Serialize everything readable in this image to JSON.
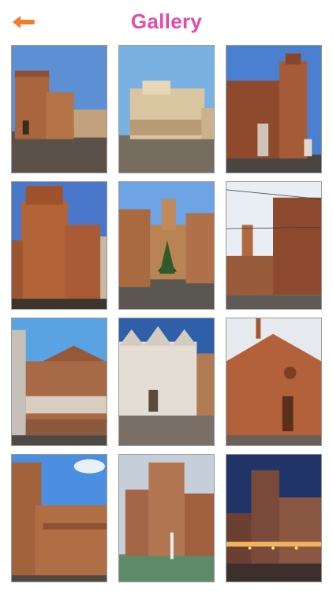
{
  "header": {
    "title": "Gallery",
    "back_icon": "back-arrow-icon",
    "back_color": "#f47a2c",
    "title_color": "#e64aa9"
  },
  "gallery": {
    "photos": [
      {
        "subject": "castle-tower-day"
      },
      {
        "subject": "piazza-cathedral-side"
      },
      {
        "subject": "square-monument-tower"
      },
      {
        "subject": "castle-towers-closeup"
      },
      {
        "subject": "street-gate-archway"
      },
      {
        "subject": "festive-street-tower"
      },
      {
        "subject": "palace-arcades"
      },
      {
        "subject": "cathedral-facade"
      },
      {
        "subject": "romanesque-church"
      },
      {
        "subject": "castle-corner-tower"
      },
      {
        "subject": "castle-moat-fountain"
      },
      {
        "subject": "castle-night-lights"
      }
    ]
  }
}
